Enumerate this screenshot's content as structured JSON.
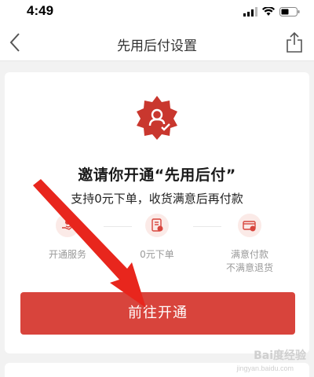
{
  "status_bar": {
    "time": "4:49",
    "icons": [
      "signal-icon",
      "wifi-icon",
      "battery-icon"
    ]
  },
  "nav": {
    "title": "先用后付设置",
    "back_icon": "chevron-left-icon",
    "share_icon": "share-icon"
  },
  "card": {
    "badge_icon": "seal-badge-icon",
    "headline": "邀请你开通“先用后付”",
    "subline": "支持0元下单，收货满意后再付款",
    "steps": [
      {
        "label": "开通服务",
        "icon": "hand-icon"
      },
      {
        "label": "0元下单",
        "icon": "document-icon"
      },
      {
        "label_line1": "满意付款",
        "label_line2": "不满意退货",
        "icon": "wallet-icon"
      }
    ],
    "cta_label": "前往开通"
  },
  "overlay": {
    "arrow_color": "#e8261d",
    "watermark": "Bai度经验",
    "watermark_sub": "jingyan.baidu.com"
  },
  "colors": {
    "accent": "#d8443c",
    "badge": "#c9372e"
  }
}
